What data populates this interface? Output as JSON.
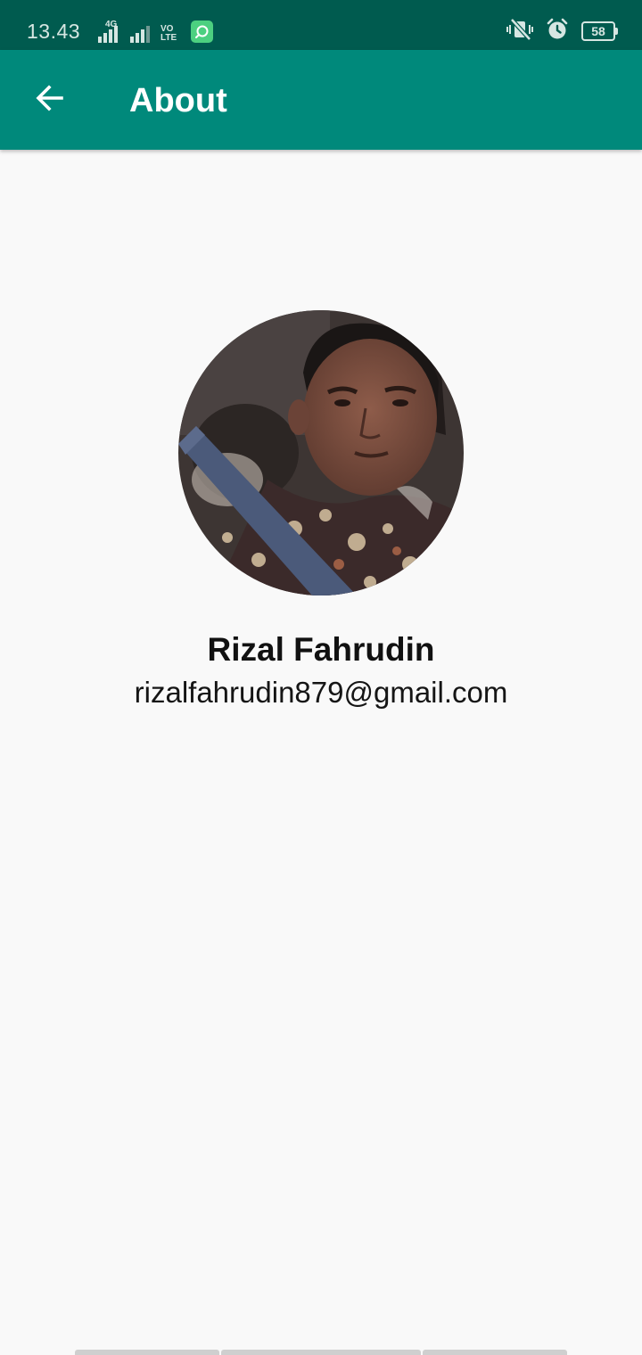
{
  "status_bar": {
    "time": "13.43",
    "network_type": "4G",
    "volte_line1": "VO",
    "volte_line2": "LTE",
    "battery_level": "58",
    "icons": [
      "signal-icon",
      "signal-icon",
      "volte-icon",
      "app-notification-icon",
      "vibrate-off-icon",
      "alarm-icon",
      "battery-icon"
    ]
  },
  "app_bar": {
    "title": "About",
    "back_icon": "arrow-left-icon"
  },
  "profile": {
    "name": "Rizal Fahrudin",
    "email": "rizalfahrudin879@gmail.com"
  },
  "colors": {
    "primary": "#00897b",
    "primary_dark": "#005b4f",
    "background": "#f9f9f9"
  }
}
